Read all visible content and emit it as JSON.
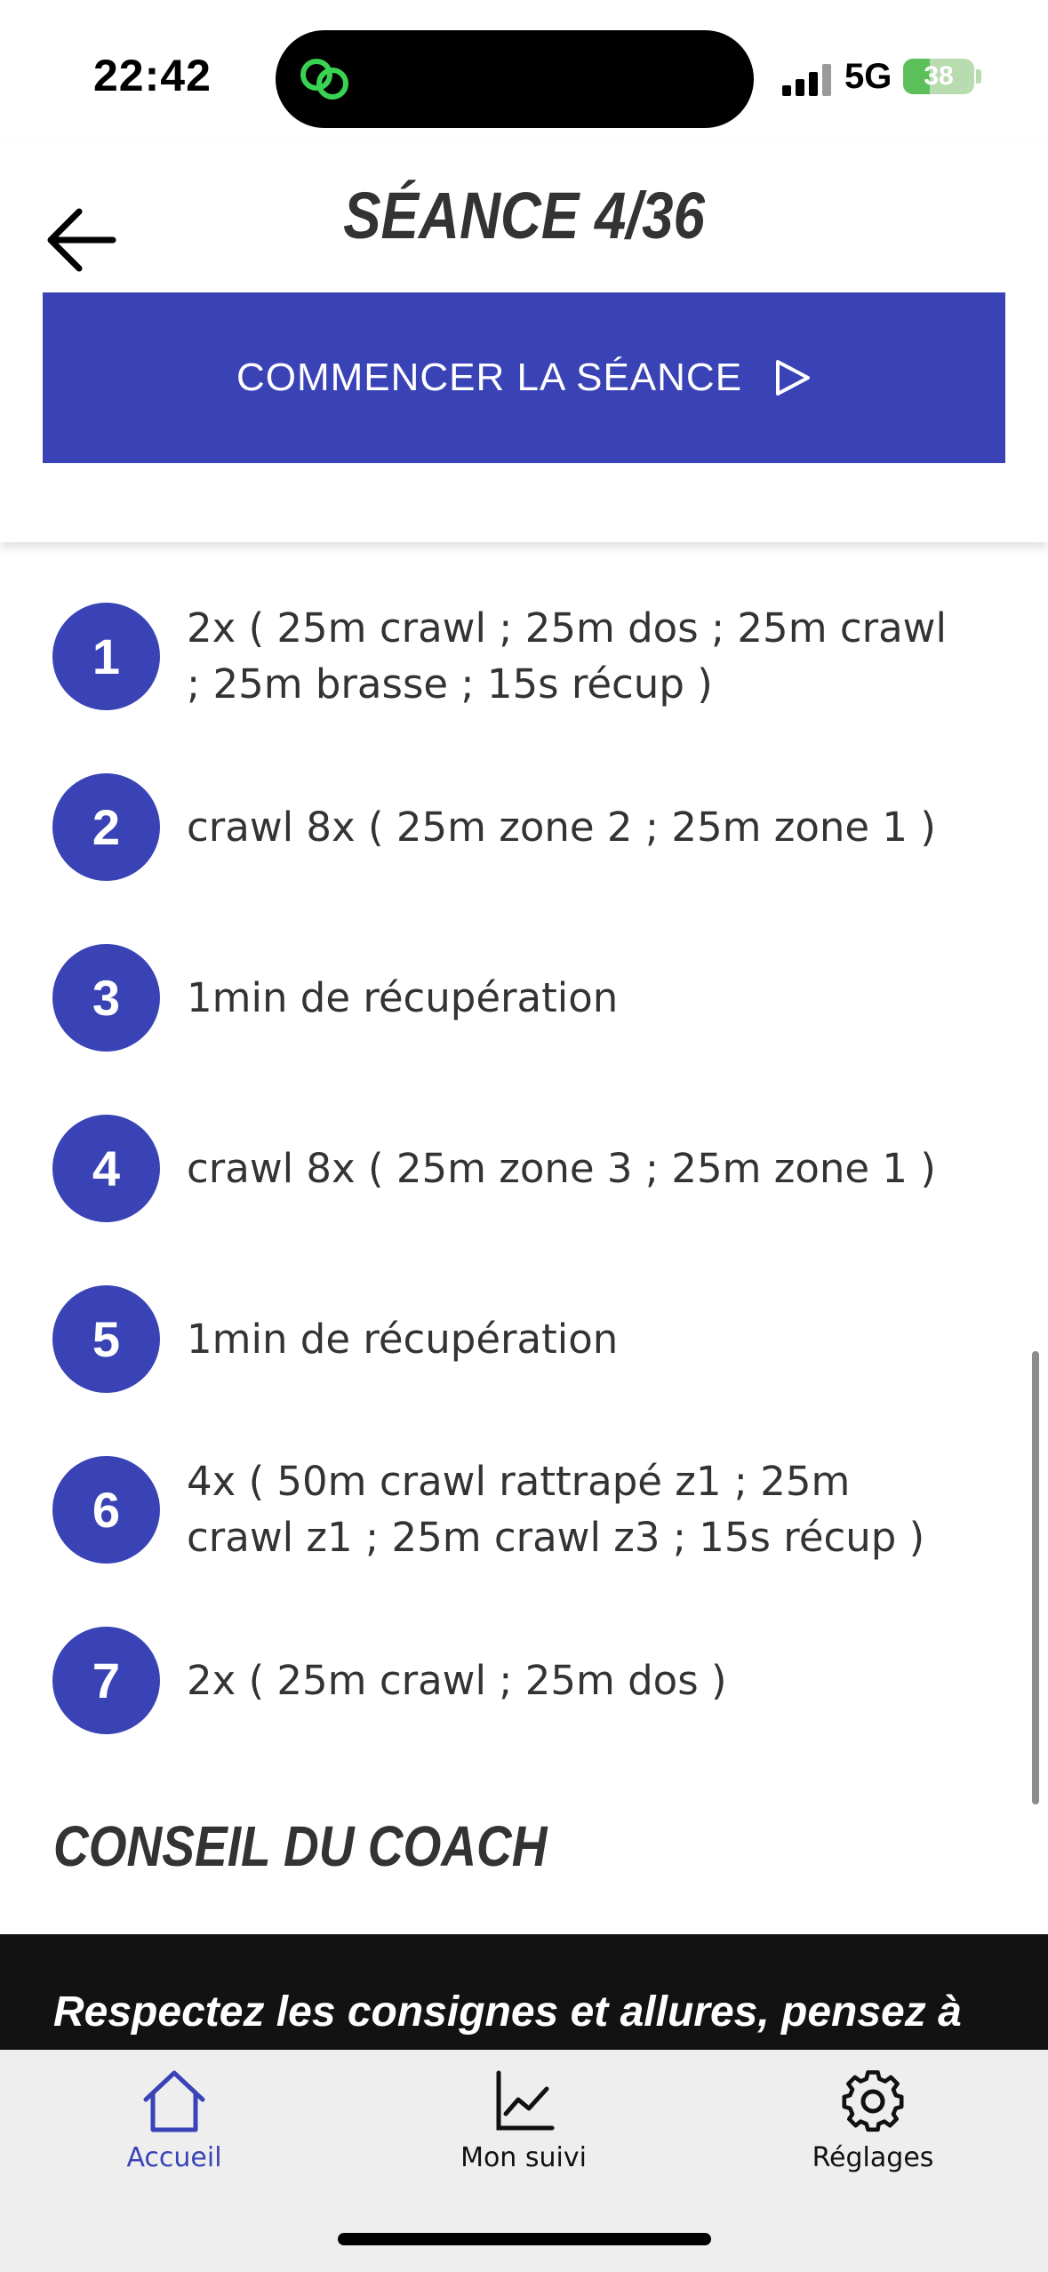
{
  "status_bar": {
    "time": "22:42",
    "network": "5G",
    "battery_percent": "38",
    "battery_level": 0.38,
    "colors": {
      "battery_fill": "#5cc05a",
      "island_icon": "#39d353"
    }
  },
  "header": {
    "title": "SÉANCE 4/36",
    "back_icon": "arrow-left-icon",
    "start_button": {
      "label": "COMMENCER LA SÉANCE",
      "icon": "play-outline-icon"
    }
  },
  "steps": [
    {
      "number": "1",
      "text": "2x ( 25m crawl ; 25m dos ; 25m crawl ; 25m brasse ; 15s récup )"
    },
    {
      "number": "2",
      "text": "crawl 8x ( 25m zone 2 ; 25m zone 1 )"
    },
    {
      "number": "3",
      "text": "1min de récupération"
    },
    {
      "number": "4",
      "text": "crawl 8x ( 25m zone 3 ; 25m zone 1 )"
    },
    {
      "number": "5",
      "text": "1min de récupération"
    },
    {
      "number": "6",
      "text": "4x ( 50m crawl rattrapé z1 ; 25m crawl z1 ; 25m crawl z3 ; 15s récup )"
    },
    {
      "number": "7",
      "text": "2x ( 25m crawl ; 25m dos )"
    }
  ],
  "coach": {
    "title": "CONSEIL DU COACH",
    "text": "Respectez les consignes et allures, pensez à"
  },
  "tabbar": {
    "tabs": [
      {
        "label": "Accueil",
        "icon": "home-icon",
        "active": true
      },
      {
        "label": "Mon suivi",
        "icon": "chart-line-icon",
        "active": false
      },
      {
        "label": "Réglages",
        "icon": "gear-icon",
        "active": false
      }
    ]
  },
  "colors": {
    "accent": "#3a43b6",
    "text": "#333333",
    "coach_bg": "#121212",
    "tabbar_bg": "#eeeeee"
  }
}
